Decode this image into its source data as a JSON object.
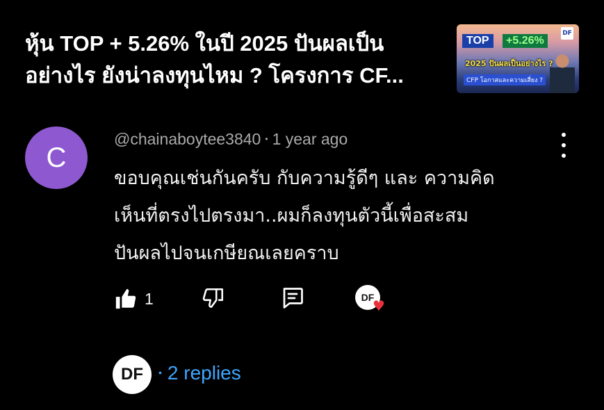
{
  "video": {
    "title_line1": "หุ้น TOP + 5.26% ในปี 2025 ปันผลเป็น",
    "title_line2": "อย่างไร ยังน่าลงทุนไหม ? โครงการ CF...",
    "thumbnail": {
      "badge": "TOP",
      "pct": "+5.26%",
      "line2": "2025 ปันผลเป็นอย่างไร ?",
      "line3": "CFP โอกาสและความเสี่ยง ?"
    }
  },
  "comment": {
    "avatar_letter": "C",
    "handle": "@chainaboytee3840",
    "separator": "•",
    "time": "1 year ago",
    "text_lines": [
      "ขอบคุณเช่นกันครับ  กับความรู้ดีๆ และ ความคิด",
      "เห็นที่ตรงไปตรงมา..ผมก็ลงทุนตัวนี้เพื่อสะสม",
      "ปันผลไปจนเกษียณเลยคราบ"
    ],
    "like_count": "1",
    "creator_heart_badge": "DF",
    "icons": [
      "like-icon",
      "dislike-icon",
      "reply-icon",
      "more-vert-icon",
      "heart-icon"
    ]
  },
  "replies": {
    "avatar_text": "DF",
    "separator": "•",
    "label": "2 replies",
    "color": "#3ea6ff"
  },
  "colors": {
    "background": "#000000",
    "avatar": "#8e59d0",
    "heart": "#e8323b"
  }
}
